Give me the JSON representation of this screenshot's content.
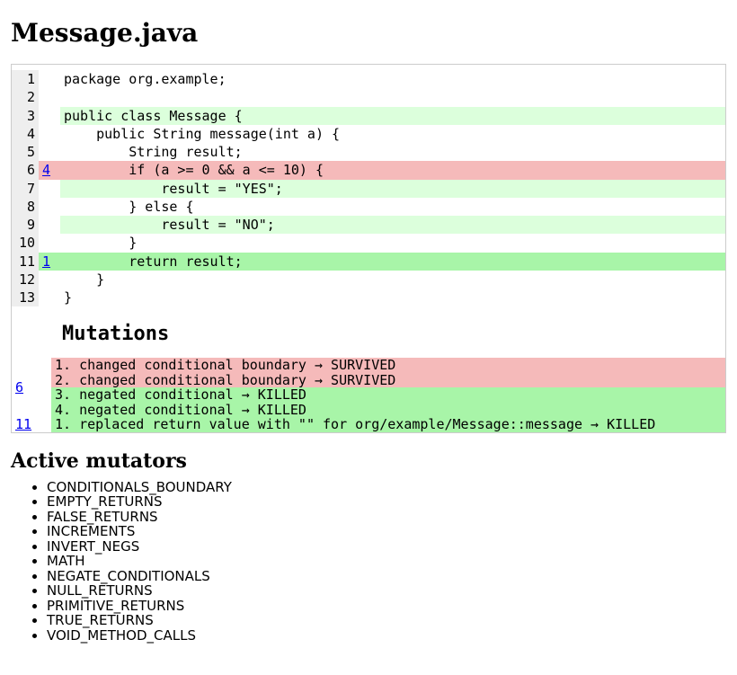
{
  "title": "Message.java",
  "code_lines": [
    {
      "n": 1,
      "mut": "",
      "mutclass": "",
      "codeclass": "",
      "text": "package org.example;"
    },
    {
      "n": 2,
      "mut": "",
      "mutclass": "",
      "codeclass": "",
      "text": ""
    },
    {
      "n": 3,
      "mut": "",
      "mutclass": "",
      "codeclass": "green",
      "text": "public class Message {"
    },
    {
      "n": 4,
      "mut": "",
      "mutclass": "",
      "codeclass": "",
      "text": "    public String message(int a) {"
    },
    {
      "n": 5,
      "mut": "",
      "mutclass": "",
      "codeclass": "",
      "text": "        String result;"
    },
    {
      "n": 6,
      "mut": "4",
      "mutclass": "pink",
      "codeclass": "pink",
      "text": "        if (a >= 0 && a <= 10) {"
    },
    {
      "n": 7,
      "mut": "",
      "mutclass": "",
      "codeclass": "green",
      "text": "            result = \"YES\";"
    },
    {
      "n": 8,
      "mut": "",
      "mutclass": "",
      "codeclass": "",
      "text": "        } else {"
    },
    {
      "n": 9,
      "mut": "",
      "mutclass": "",
      "codeclass": "green",
      "text": "            result = \"NO\";"
    },
    {
      "n": 10,
      "mut": "",
      "mutclass": "",
      "codeclass": "",
      "text": "        }"
    },
    {
      "n": 11,
      "mut": "1",
      "mutclass": "green-strong",
      "codeclass": "green-strong",
      "text": "        return result;"
    },
    {
      "n": 12,
      "mut": "",
      "mutclass": "",
      "codeclass": "",
      "text": "    }"
    },
    {
      "n": 13,
      "mut": "",
      "mutclass": "",
      "codeclass": "",
      "text": "}"
    }
  ],
  "mutations_heading": "Mutations",
  "mutations": [
    {
      "line": "6",
      "items": [
        {
          "text": "1. changed conditional boundary → SURVIVED",
          "class": "pink-mut"
        },
        {
          "text": "2. changed conditional boundary → SURVIVED",
          "class": "pink-mut"
        },
        {
          "text": "3. negated conditional → KILLED",
          "class": "green-mut"
        },
        {
          "text": "4. negated conditional → KILLED",
          "class": "green-mut"
        }
      ]
    },
    {
      "line": "11",
      "items": [
        {
          "text": "1. replaced return value with \"\" for org/example/Message::message → KILLED",
          "class": "green-mut"
        }
      ]
    }
  ],
  "mutators_heading": "Active mutators",
  "mutators": [
    "CONDITIONALS_BOUNDARY",
    "EMPTY_RETURNS",
    "FALSE_RETURNS",
    "INCREMENTS",
    "INVERT_NEGS",
    "MATH",
    "NEGATE_CONDITIONALS",
    "NULL_RETURNS",
    "PRIMITIVE_RETURNS",
    "TRUE_RETURNS",
    "VOID_METHOD_CALLS"
  ]
}
